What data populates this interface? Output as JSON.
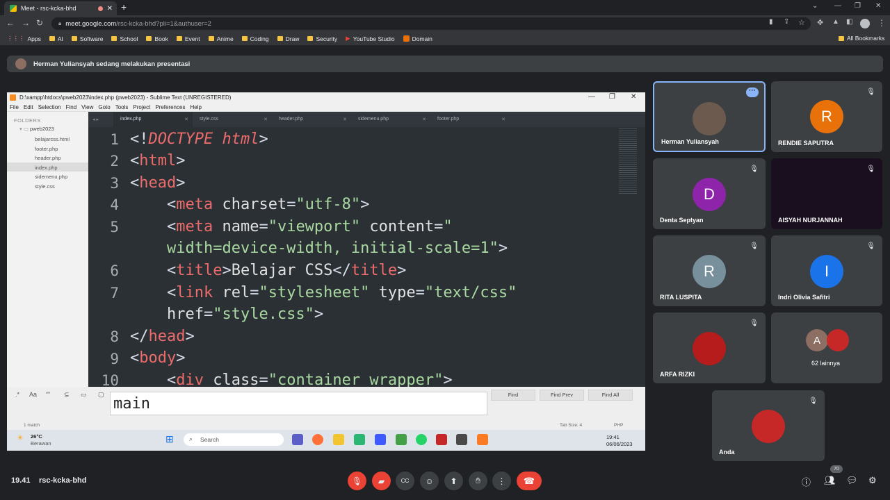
{
  "browser": {
    "tab_title": "Meet - rsc-kcka-bhd",
    "url_host": "meet.google.com",
    "url_path": "/rsc-kcka-bhd?pli=1&authuser=2",
    "bookmarks": [
      "Apps",
      "AI",
      "Software",
      "School",
      "Book",
      "Event",
      "Anime",
      "Coding",
      "Draw",
      "Security",
      "YouTube Studio",
      "Domain"
    ],
    "all_bookmarks": "All Bookmarks"
  },
  "banner": {
    "text": "Herman Yuliansyah sedang melakukan presentasi"
  },
  "sublime": {
    "title": "D:\\xampp\\htdocs\\pweb2023\\index.php (pweb2023) - Sublime Text (UNREGISTERED)",
    "menu": [
      "File",
      "Edit",
      "Selection",
      "Find",
      "View",
      "Goto",
      "Tools",
      "Project",
      "Preferences",
      "Help"
    ],
    "folders_label": "FOLDERS",
    "project": "pweb2023",
    "files": [
      "belajarcss.html",
      "footer.php",
      "header.php",
      "index.php",
      "sidemenu.php",
      "style.css"
    ],
    "tabs": [
      "index.php",
      "style.css",
      "header.php",
      "sidemenu.php",
      "footer.php"
    ],
    "line_numbers": [
      "1",
      "2",
      "3",
      "4",
      "5",
      "",
      "6",
      "7",
      "",
      "8",
      "9",
      "10"
    ],
    "find_value": "main",
    "find_buttons": [
      "Find",
      "Find Prev",
      "Find All"
    ],
    "status_left": "1 match",
    "status_tab": "Tab Size: 4",
    "status_syntax": "PHP"
  },
  "windows_taskbar": {
    "temp": "26°C",
    "weather": "Berawan",
    "search": "Search",
    "time": "19:41",
    "date": "06/06/2023"
  },
  "participants": [
    {
      "name": "Herman Yuliansyah",
      "initial": "",
      "color": "#6d5a4e"
    },
    {
      "name": "RENDIE SAPUTRA",
      "initial": "R",
      "color": "#e8710a"
    },
    {
      "name": "Denta Septyan",
      "initial": "D",
      "color": "#8e24aa"
    },
    {
      "name": "AISYAH NURJANNAH",
      "initial": "",
      "color": "#1a0f1e"
    },
    {
      "name": "RITA LUSPITA",
      "initial": "R",
      "color": "#78909c"
    },
    {
      "name": "Indri Olivia Safitri",
      "initial": "I",
      "color": "#1a73e8"
    },
    {
      "name": "ARFA RIZKI",
      "initial": "",
      "color": "#b71c1c"
    },
    {
      "name": "62 lainnya",
      "initial": "A",
      "color": "#8d6e63"
    },
    {
      "name": "Anda",
      "initial": "",
      "color": "#c62828"
    }
  ],
  "meet_bar": {
    "time": "19.41",
    "code": "rsc-kcka-bhd",
    "participant_count": "70"
  }
}
